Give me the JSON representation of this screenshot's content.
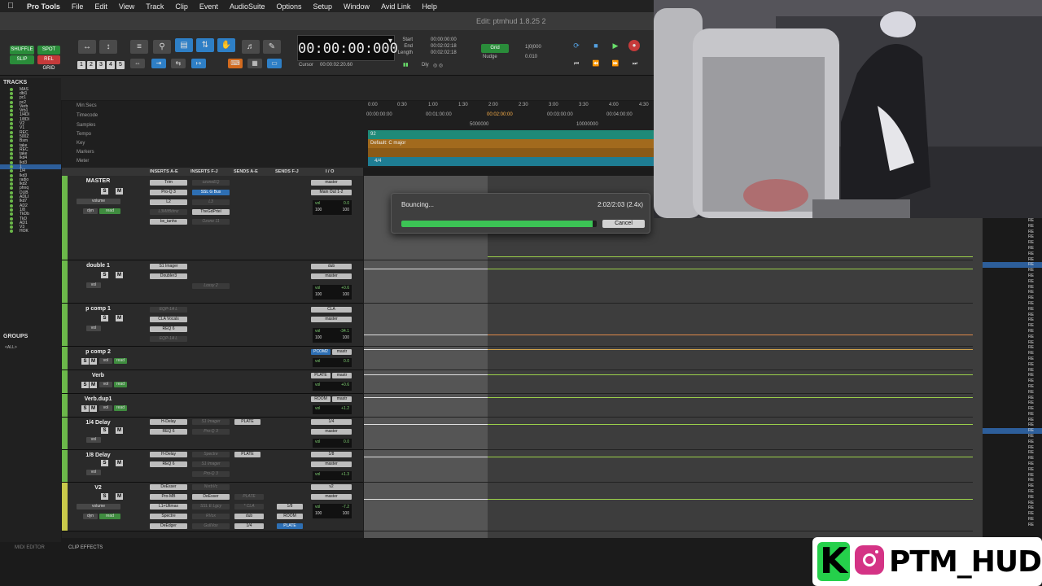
{
  "menubar": {
    "app_name": "Pro Tools",
    "items": [
      "File",
      "Edit",
      "View",
      "Track",
      "Clip",
      "Event",
      "AudioSuite",
      "Options",
      "Setup",
      "Window",
      "Avid Link",
      "Help"
    ]
  },
  "window": {
    "title": "Edit: ptmhud 1.8.25 2"
  },
  "toolbar": {
    "modes": [
      "SHUFFLE",
      "SPOT",
      "SLIP",
      "REL GRID"
    ],
    "zoom_presets": [
      "1",
      "2",
      "3",
      "4",
      "5"
    ],
    "main_counter": "00:00:00:000",
    "start_label": "Start",
    "start_value": "00:00:00:00",
    "end_label": "End",
    "end_value": "00:02:02:18",
    "length_label": "Length",
    "length_value": "00:02:02:18",
    "cursor_label": "Cursor",
    "cursor_value": "00:00:02:20.60",
    "grid_label": "Grid",
    "grid_value": "1|0|000",
    "nudge_label": "Nudge",
    "nudge_value": "0.010"
  },
  "tracks_list": {
    "header": "TRACKS",
    "items": [
      "MAS",
      "dbl1",
      "pc1",
      "pc2",
      "Verb",
      "Vrb1",
      "1/4DI",
      "1/8DI",
      "V2",
      "V1",
      "REC",
      "500Z",
      "Bsm",
      "take",
      "REC",
      "take",
      "lkd4",
      "lkd3",
      "1",
      "1/4",
      "lkd3",
      "radio",
      "lkd2",
      "phnq",
      "DUB",
      "ADLI",
      "lkd7",
      "AD2",
      "1/8",
      "TkDb",
      "TkD",
      "AD1",
      "V3",
      "HOK"
    ]
  },
  "groups": {
    "header": "GROUPS",
    "item": "<ALL>"
  },
  "rulers": {
    "rows": [
      "Min:Secs",
      "Timecode",
      "Samples",
      "Tempo",
      "Key",
      "Markers",
      "Meter"
    ],
    "min_secs": [
      "0:00",
      "0:30",
      "1:00",
      "1:30",
      "2:00",
      "2:30",
      "3:00",
      "3:30",
      "4:00",
      "4:30"
    ],
    "timecode": [
      "00:00:00:00",
      "00:01:00:00",
      "00:02:00:00",
      "00:03:00:00",
      "00:04:00:00"
    ],
    "samples": [
      "5000000",
      "10000000"
    ],
    "tempo_value": "92",
    "key_value": "Default: C major",
    "meter_value": "4/4"
  },
  "column_headers": [
    "INSERTS A-E",
    "INSERTS F-J",
    "SENDS A-E",
    "SENDS F-J",
    "I / O"
  ],
  "mix_tracks": [
    {
      "name": "MASTER",
      "ins_a": [
        "Trim",
        "Pro-Q 3",
        "L2",
        "L3MltBdmz",
        "bx_tanhs"
      ],
      "ins_f": [
        "ozoneEQ",
        "SSL G Bus",
        "L3",
        "TheGdPrtel",
        "Ozone 11"
      ],
      "io": [
        "master",
        "Main Out 1-2"
      ],
      "vol": "vol",
      "vol_val": "0.0",
      "l": "100",
      "r": "100"
    },
    {
      "name": "double 1",
      "ins_a": [
        "S1 Imager",
        "Doubler3"
      ],
      "ins_f": [
        "",
        "Lossy 2"
      ],
      "io": [
        "dub",
        "master"
      ],
      "vol": "vol",
      "vol_val": "+0.6",
      "l": "100",
      "r": "100"
    },
    {
      "name": "p comp 1",
      "ins_a": [
        "EQP-1A L",
        "CLA Vocals",
        "REQ 6",
        "EQP-1A L"
      ],
      "ins_f": [],
      "io": [
        "CLA",
        "master"
      ],
      "vol": "vol",
      "vol_val": "-34.1",
      "l": "100",
      "r": "100"
    },
    {
      "name": "p comp 2",
      "ins_a": [],
      "ins_f": [],
      "io": [
        "PCOM2",
        "mastr"
      ],
      "vol": "vol",
      "vol_val": "0.0"
    },
    {
      "name": "Verb",
      "ins_a": [],
      "ins_f": [],
      "io": [
        "PLATE",
        "mastr"
      ],
      "vol": "vol",
      "vol_val": "+0.6"
    },
    {
      "name": "Verb.dup1",
      "ins_a": [],
      "ins_f": [],
      "io": [
        "ROOM",
        "mastr"
      ],
      "vol": "vol",
      "vol_val": "+1.2"
    },
    {
      "name": "1/4 Delay",
      "ins_a": [
        "H-Delay",
        "REQ 6"
      ],
      "ins_f": [
        "S1 Imager",
        "Pro-Q 3"
      ],
      "send": "PLATE",
      "io": [
        "1/4",
        "master"
      ],
      "vol": "vol",
      "vol_val": "0.0"
    },
    {
      "name": "1/8 Delay",
      "ins_a": [
        "H-Delay",
        "REQ 6"
      ],
      "ins_f": [
        "Spectre",
        "S1 Imager",
        "Pro-Q 3"
      ],
      "send": "PLATE",
      "io": [
        "1/8",
        "master"
      ],
      "vol": "vol",
      "vol_val": "+1.3"
    },
    {
      "name": "V2",
      "ins_a": [
        "DeEsser",
        "Pro-MB",
        "L1+Ultmax",
        "Spectre",
        "DeEdger"
      ],
      "ins_f": [
        "NvrbVc",
        "DeEsser",
        "SSL E Lgcy",
        "RVox",
        "GullVox"
      ],
      "send_a": [
        "PLATE",
        "* CLA",
        "dub",
        "1/4"
      ],
      "send_f": [
        "1/8",
        "ROOM",
        "PLATE"
      ],
      "io": [
        "v2",
        "master"
      ],
      "vol": "vol",
      "vol_val": "-7.2",
      "l": "100",
      "r": "100"
    }
  ],
  "track_sub": {
    "volume": "volume",
    "dyn": "dyn",
    "read": "read",
    "solo": "S",
    "mute": "M"
  },
  "bounce": {
    "status": "Bouncing...",
    "time": "2:02/2:03 (2.4x)",
    "progress": 0.98,
    "cancel": "Cancel"
  },
  "bottom_bar": {
    "midi_editor": "MIDI EDITOR",
    "clip_effects": "CLIP EFFECTS"
  },
  "social": {
    "handle": "PTM_HUD",
    "k_logo": "K"
  },
  "right_strip": [
    "RE",
    "RE",
    "RE",
    "RE",
    "RE",
    "RE",
    "RE",
    "RE",
    "RE",
    "RE",
    "RE",
    "RE",
    "RE",
    "RE",
    "RE",
    "RE",
    "RE",
    "RE",
    "RE",
    "RE",
    "RE",
    "RE",
    "RE",
    "RE",
    "RE",
    "RE",
    "RE",
    "RE",
    "RE",
    "RE",
    "RE",
    "RE",
    "RE",
    "RE",
    "RE",
    "RE",
    "RE",
    "RE",
    "RE",
    "RE",
    "RE",
    "RE",
    "RE",
    "RE",
    "RE",
    "RE",
    "RE",
    "RE",
    "RE",
    "RE",
    "RE",
    "RE",
    "RE",
    "RE",
    "RE",
    "RE"
  ],
  "colors": {
    "accent": "#2e7fc6",
    "progress": "#3cc455",
    "track_green": "#9bd04a"
  }
}
